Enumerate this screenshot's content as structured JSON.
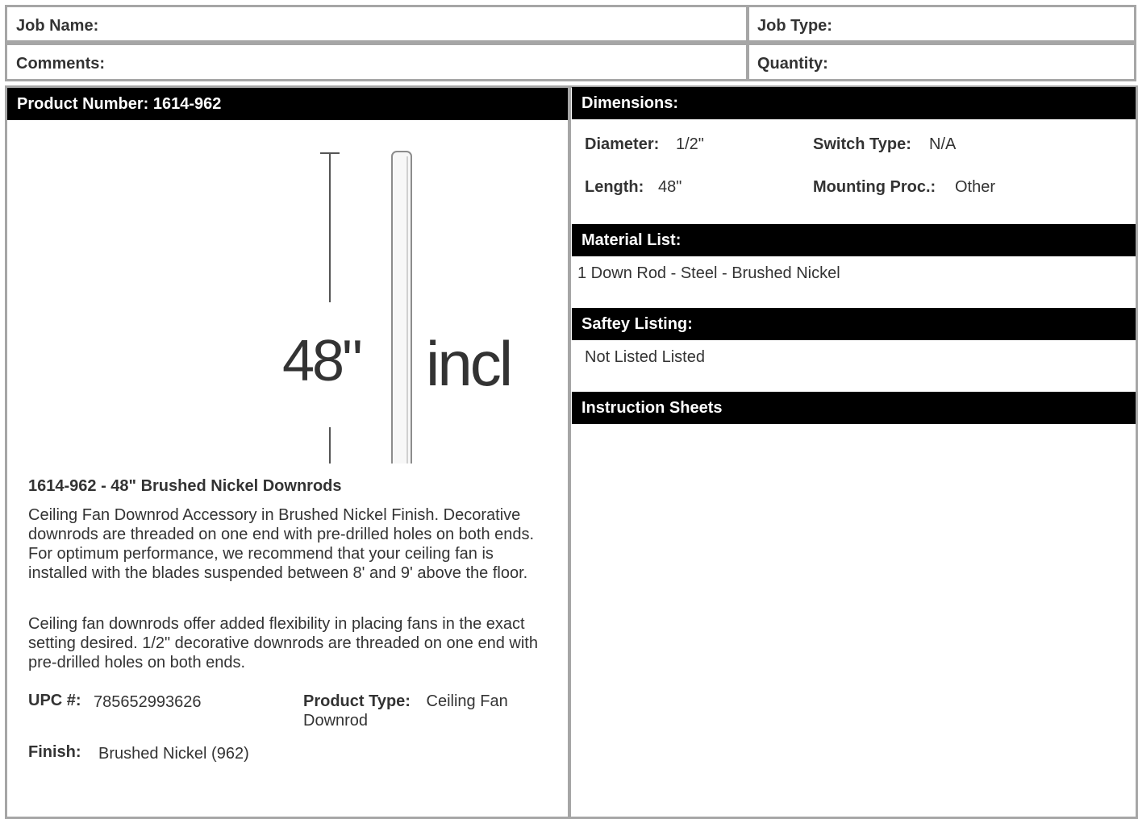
{
  "job": {
    "job_name_label": "Job Name:",
    "job_type_label": "Job Type:",
    "comments_label": "Comments:",
    "quantity_label": "Quantity:"
  },
  "product": {
    "header": "Product Number: 1614-962",
    "image_text": {
      "length": "48\"",
      "unit": "incl"
    },
    "title": "1614-962 - 48\" Brushed Nickel Downrods",
    "description_1": "Ceiling Fan Downrod Accessory in Brushed Nickel Finish. Decorative downrods are threaded on one end with pre-drilled holes on both ends. For optimum performance, we recommend that your ceiling fan is installed with the blades suspended between 8' and 9' above the floor.",
    "description_2": "Ceiling fan downrods offer added flexibility in placing fans in the exact setting desired. 1/2\" decorative downrods are threaded on one end with pre-drilled holes on both ends.",
    "upc_label": "UPC #:",
    "upc_value": "785652993626",
    "type_label": "Product Type:",
    "type_value": "Ceiling Fan Downrod",
    "finish_label": "Finish:",
    "finish_value": "Brushed Nickel (962)"
  },
  "dimensions": {
    "header": "Dimensions:",
    "diameter_label": "Diameter:",
    "diameter_value": "1/2\"",
    "switch_label": "Switch Type:",
    "switch_value": "N/A",
    "length_label": "Length:",
    "length_value": "48\"",
    "mounting_label": "Mounting Proc.:",
    "mounting_value": "Other"
  },
  "material": {
    "header": "Material List:",
    "item": "1 Down Rod - Steel - Brushed Nickel"
  },
  "safety": {
    "header": "Saftey Listing:",
    "value": "Not Listed Listed"
  },
  "instructions": {
    "header": "Instruction Sheets"
  }
}
